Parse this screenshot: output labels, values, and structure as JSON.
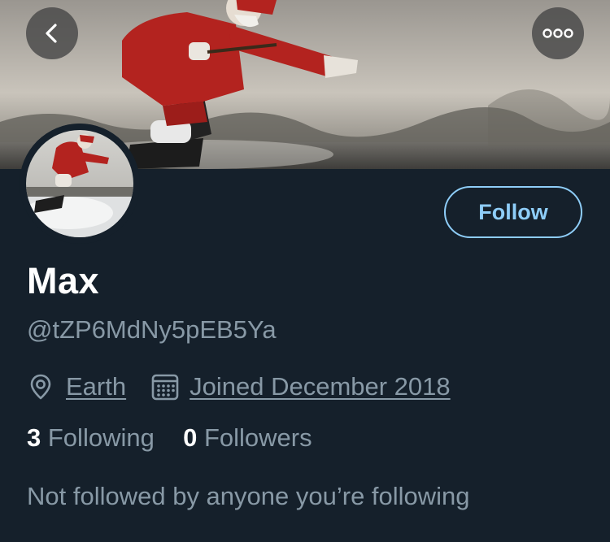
{
  "header": {
    "back_icon": "chevron-left-icon",
    "more_icon": "more-dots-icon",
    "banner_description_icon": "banner-image"
  },
  "profile": {
    "display_name": "Max",
    "handle": "@tZP6MdNy5pEB5Ya",
    "location_icon": "location-pin-icon",
    "location": "Earth",
    "calendar_icon": "calendar-icon",
    "joined": "Joined December 2018",
    "following_count": "3",
    "following_label": "Following",
    "followers_count": "0",
    "followers_label": "Followers",
    "mutual_text": "Not followed by anyone you’re following"
  },
  "actions": {
    "follow_label": "Follow"
  },
  "colors": {
    "background": "#15202b",
    "accent": "#8ecdf8",
    "secondary_text": "#8899a6",
    "primary_text": "#ffffff"
  }
}
